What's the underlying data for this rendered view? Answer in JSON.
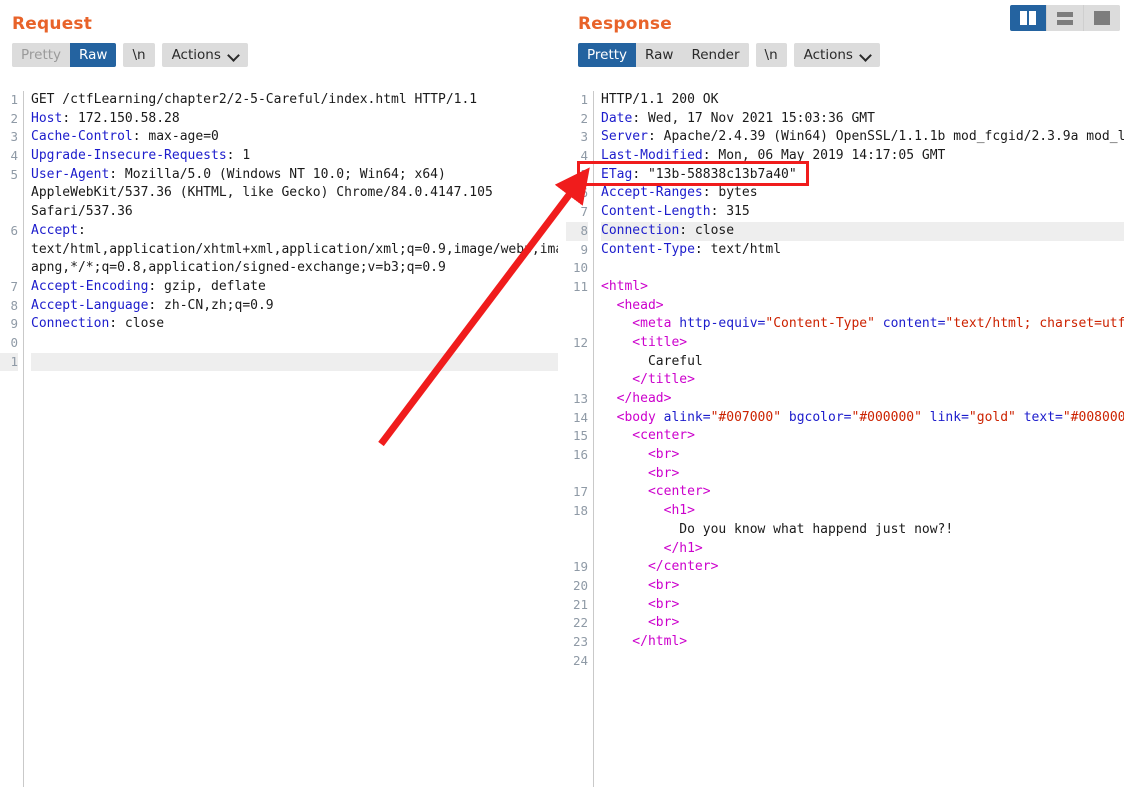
{
  "window": {
    "layout_toggle": {
      "buttons": [
        {
          "name": "side-by-side-layout",
          "icon": "split-columns-icon",
          "active": true
        },
        {
          "name": "stacked-layout",
          "icon": "split-rows-icon",
          "active": false
        },
        {
          "name": "single-pane-layout",
          "icon": "single-pane-icon",
          "active": false
        }
      ]
    }
  },
  "request": {
    "title": "Request",
    "toolbar": {
      "view_modes": [
        "Pretty",
        "Raw"
      ],
      "active_view": "Raw",
      "newline_label": "\\n",
      "actions_label": "Actions"
    },
    "lines": [
      {
        "n": "1",
        "segs": [
          {
            "c": "t",
            "s": "GET /ctfLearning/chapter2/2-5-Careful/index.html HTTP/1.1"
          }
        ]
      },
      {
        "n": "2",
        "segs": [
          {
            "c": "k",
            "s": "Host"
          },
          {
            "c": "t",
            "s": ": 172.150.58.28"
          }
        ]
      },
      {
        "n": "3",
        "segs": [
          {
            "c": "k",
            "s": "Cache-Control"
          },
          {
            "c": "t",
            "s": ": max-age=0"
          }
        ]
      },
      {
        "n": "4",
        "segs": [
          {
            "c": "k",
            "s": "Upgrade-Insecure-Requests"
          },
          {
            "c": "t",
            "s": ": 1"
          }
        ]
      },
      {
        "n": "5",
        "segs": [
          {
            "c": "k",
            "s": "User-Agent"
          },
          {
            "c": "t",
            "s": ": Mozilla/5.0 (Windows NT 10.0; Win64; x64)"
          }
        ]
      },
      {
        "n": "",
        "segs": [
          {
            "c": "t",
            "s": "AppleWebKit/537.36 (KHTML, like Gecko) Chrome/84.0.4147.105"
          }
        ]
      },
      {
        "n": "",
        "segs": [
          {
            "c": "t",
            "s": "Safari/537.36"
          }
        ]
      },
      {
        "n": "6",
        "segs": [
          {
            "c": "k",
            "s": "Accept"
          },
          {
            "c": "t",
            "s": ":"
          }
        ]
      },
      {
        "n": "",
        "segs": [
          {
            "c": "t",
            "s": "text/html,application/xhtml+xml,application/xml;q=0.9,image/webp,ima"
          }
        ]
      },
      {
        "n": "",
        "segs": [
          {
            "c": "t",
            "s": "apng,*/*;q=0.8,application/signed-exchange;v=b3;q=0.9"
          }
        ]
      },
      {
        "n": "7",
        "segs": [
          {
            "c": "k",
            "s": "Accept-Encoding"
          },
          {
            "c": "t",
            "s": ": gzip, deflate"
          }
        ]
      },
      {
        "n": "8",
        "segs": [
          {
            "c": "k",
            "s": "Accept-Language"
          },
          {
            "c": "t",
            "s": ": zh-CN,zh;q=0.9"
          }
        ]
      },
      {
        "n": "9",
        "segs": [
          {
            "c": "k",
            "s": "Connection"
          },
          {
            "c": "t",
            "s": ": close"
          }
        ]
      },
      {
        "n": "0",
        "segs": [
          {
            "c": "t",
            "s": ""
          }
        ]
      },
      {
        "n": "1",
        "segs": [
          {
            "c": "t",
            "s": ""
          }
        ],
        "hl": true
      }
    ]
  },
  "response": {
    "title": "Response",
    "toolbar": {
      "view_modes": [
        "Pretty",
        "Raw",
        "Render"
      ],
      "active_view": "Pretty",
      "newline_label": "\\n",
      "actions_label": "Actions"
    },
    "lines": [
      {
        "n": "1",
        "segs": [
          {
            "c": "t",
            "s": "HTTP/1.1 200 OK"
          }
        ]
      },
      {
        "n": "2",
        "segs": [
          {
            "c": "k",
            "s": "Date"
          },
          {
            "c": "t",
            "s": ": Wed, 17 Nov 2021 15:03:36 GMT"
          }
        ]
      },
      {
        "n": "3",
        "segs": [
          {
            "c": "k",
            "s": "Server"
          },
          {
            "c": "t",
            "s": ": Apache/2.4.39 (Win64) OpenSSL/1.1.1b mod_fcgid/2.3.9a mod_l"
          }
        ]
      },
      {
        "n": "4",
        "segs": [
          {
            "c": "k",
            "s": "Last-Modified"
          },
          {
            "c": "t",
            "s": ": Mon, 06 May 2019 14:17:05 GMT"
          }
        ]
      },
      {
        "n": "5",
        "segs": [
          {
            "c": "k",
            "s": "ETag"
          },
          {
            "c": "t",
            "s": ": \"13b-58838c13b7a40\""
          }
        ]
      },
      {
        "n": "6",
        "segs": [
          {
            "c": "k",
            "s": "Accept-Ranges"
          },
          {
            "c": "t",
            "s": ": bytes"
          }
        ]
      },
      {
        "n": "7",
        "segs": [
          {
            "c": "k",
            "s": "Content-Length"
          },
          {
            "c": "t",
            "s": ": 315"
          }
        ]
      },
      {
        "n": "8",
        "segs": [
          {
            "c": "k",
            "s": "Connection"
          },
          {
            "c": "t",
            "s": ": close"
          }
        ],
        "hl": true
      },
      {
        "n": "9",
        "segs": [
          {
            "c": "k",
            "s": "Content-Type"
          },
          {
            "c": "t",
            "s": ": text/html"
          }
        ]
      },
      {
        "n": "10",
        "segs": [
          {
            "c": "t",
            "s": ""
          }
        ]
      },
      {
        "n": "11",
        "segs": [
          {
            "c": "tag",
            "s": "<html>"
          }
        ]
      },
      {
        "n": "",
        "segs": [
          {
            "c": "tag",
            "s": "  <head>"
          }
        ]
      },
      {
        "n": "",
        "segs": [
          {
            "c": "tag",
            "s": "    <meta "
          },
          {
            "c": "at",
            "s": "http-equiv="
          },
          {
            "c": "av",
            "s": "\"Content-Type\""
          },
          {
            "c": "at",
            "s": " content="
          },
          {
            "c": "av",
            "s": "\"text/html; charset=utf-"
          }
        ]
      },
      {
        "n": "12",
        "segs": [
          {
            "c": "tag",
            "s": "    <title>"
          }
        ]
      },
      {
        "n": "",
        "segs": [
          {
            "c": "t",
            "s": "      Careful"
          }
        ]
      },
      {
        "n": "",
        "segs": [
          {
            "c": "tag",
            "s": "    </title>"
          }
        ]
      },
      {
        "n": "13",
        "segs": [
          {
            "c": "tag",
            "s": "  </head>"
          }
        ]
      },
      {
        "n": "14",
        "segs": [
          {
            "c": "tag",
            "s": "  <body "
          },
          {
            "c": "at",
            "s": "alink="
          },
          {
            "c": "av",
            "s": "\"#007000\""
          },
          {
            "c": "at",
            "s": " bgcolor="
          },
          {
            "c": "av",
            "s": "\"#000000\""
          },
          {
            "c": "at",
            "s": " link="
          },
          {
            "c": "av",
            "s": "\"gold\""
          },
          {
            "c": "at",
            "s": " text="
          },
          {
            "c": "av",
            "s": "\"#008000\""
          }
        ],
        "fold": true
      },
      {
        "n": "15",
        "segs": [
          {
            "c": "tag",
            "s": "    <center>"
          }
        ]
      },
      {
        "n": "16",
        "segs": [
          {
            "c": "tag",
            "s": "      <br>"
          }
        ]
      },
      {
        "n": "",
        "segs": [
          {
            "c": "tag",
            "s": "      <br>"
          }
        ]
      },
      {
        "n": "17",
        "segs": [
          {
            "c": "tag",
            "s": "      <center>"
          }
        ]
      },
      {
        "n": "18",
        "segs": [
          {
            "c": "tag",
            "s": "        <h1>"
          }
        ]
      },
      {
        "n": "",
        "segs": [
          {
            "c": "t",
            "s": "          Do you know what happend just now?!"
          }
        ]
      },
      {
        "n": "",
        "segs": [
          {
            "c": "tag",
            "s": "        </h1>"
          }
        ]
      },
      {
        "n": "19",
        "segs": [
          {
            "c": "tag",
            "s": "      </center>"
          }
        ]
      },
      {
        "n": "20",
        "segs": [
          {
            "c": "tag",
            "s": "      <br>"
          }
        ]
      },
      {
        "n": "21",
        "segs": [
          {
            "c": "tag",
            "s": "      <br>"
          }
        ]
      },
      {
        "n": "22",
        "segs": [
          {
            "c": "tag",
            "s": "      <br>"
          }
        ]
      },
      {
        "n": "23",
        "segs": [
          {
            "c": "tag",
            "s": "    </html>"
          }
        ]
      },
      {
        "n": "24",
        "segs": [
          {
            "c": "t",
            "s": ""
          }
        ]
      }
    ]
  },
  "annotations": {
    "etag_box": {
      "color": "#f01c1c",
      "target": "ETag: \"13b-58838c13b7a40\""
    },
    "arrow": {
      "color": "#f01c1c",
      "from": "request-pane-lower-left",
      "to": "etag-line"
    }
  },
  "colors": {
    "title": "#e8632a",
    "active_tab_bg": "#2463a0",
    "toolbar_bg": "#dcdcdc",
    "header_name": "#1c1ccc",
    "html_tag": "#cc00cc",
    "attr_value": "#cc2200",
    "annotation_red": "#f01c1c"
  }
}
